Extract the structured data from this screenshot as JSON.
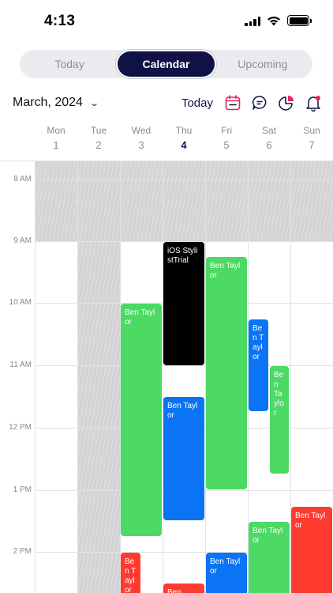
{
  "status": {
    "time": "4:13"
  },
  "tabs": [
    {
      "label": "Today",
      "active": false
    },
    {
      "label": "Calendar",
      "active": true
    },
    {
      "label": "Upcoming",
      "active": false
    }
  ],
  "header": {
    "month": "March, 2024",
    "today_label": "Today",
    "icons": [
      "calendar-icon",
      "chat-icon",
      "pie-chart-icon",
      "bell-icon"
    ]
  },
  "days": [
    {
      "name": "Mon",
      "num": "1"
    },
    {
      "name": "Tue",
      "num": "2"
    },
    {
      "name": "Wed",
      "num": "3"
    },
    {
      "name": "Thu",
      "num": "4",
      "today": true
    },
    {
      "name": "Fri",
      "num": "5"
    },
    {
      "name": "Sat",
      "num": "6"
    },
    {
      "name": "Sun",
      "num": "7"
    }
  ],
  "hours": [
    "8 AM",
    "9 AM",
    "10 AM",
    "11 AM",
    "12 PM",
    "1 PM",
    "2 PM"
  ],
  "colors": {
    "green": "#4cd964",
    "blue": "#0a74f5",
    "black": "#000000",
    "red": "#ff3b30",
    "accent": "#0f1147"
  },
  "events": [
    {
      "title": "iOS StylistTrial",
      "color": "black"
    },
    {
      "title": "Ben Taylor",
      "color": "green"
    },
    {
      "title": "Ben Taylor",
      "color": "green"
    },
    {
      "title": "Ben Taylor",
      "color": "blue"
    },
    {
      "title": "Ben Taylor",
      "color": "green"
    },
    {
      "title": "Ben Taylor",
      "color": "blue"
    },
    {
      "title": "Ben Taylor",
      "color": "red"
    },
    {
      "title": "Ben Taylor",
      "color": "green"
    },
    {
      "title": "Ben Taylor",
      "color": "red"
    },
    {
      "title": "Ben Taylor",
      "color": "blue"
    },
    {
      "title": "Ben",
      "color": "red"
    }
  ]
}
